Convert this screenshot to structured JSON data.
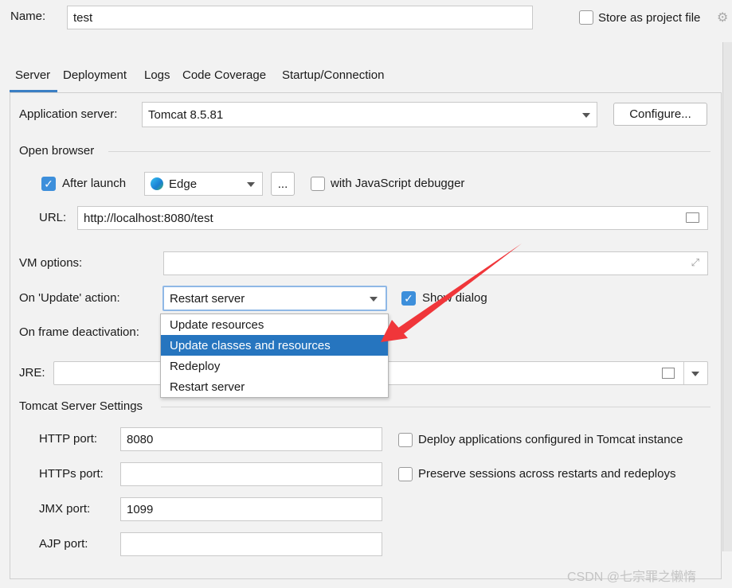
{
  "name": {
    "label": "Name:",
    "value": "test"
  },
  "store": {
    "label": "Store as project file",
    "checked": false
  },
  "tabs": [
    {
      "label": "Server",
      "active": true
    },
    {
      "label": "Deployment"
    },
    {
      "label": "Logs"
    },
    {
      "label": "Code Coverage"
    },
    {
      "label": "Startup/Connection"
    }
  ],
  "server": {
    "app_server_label": "Application server:",
    "app_server_value": "Tomcat 8.5.81",
    "configure": "Configure...",
    "open_browser": "Open browser",
    "after_launch": "After launch",
    "browser": "Edge",
    "browse_more": "...",
    "js_debugger": "with JavaScript debugger",
    "url_label": "URL:",
    "url_value": "http://localhost:8080/test",
    "vm_label": "VM options:",
    "vm_value": "",
    "update_label": "On 'Update' action:",
    "update_value": "Restart server",
    "show_dialog": "Show dialog",
    "frame_label": "On frame deactivation:",
    "jre_label": "JRE:",
    "jre_value": "",
    "dropdown": [
      "Update resources",
      "Update classes and resources",
      "Redeploy",
      "Restart server"
    ],
    "tomcat_settings": "Tomcat Server Settings",
    "http_label": "HTTP port:",
    "http_value": "8080",
    "https_label": "HTTPs port:",
    "https_value": "",
    "jmx_label": "JMX port:",
    "jmx_value": "1099",
    "ajp_label": "AJP port:",
    "ajp_value": "",
    "deploy_configured": "Deploy applications configured in Tomcat instance",
    "preserve_sessions": "Preserve sessions across restarts and redeploys"
  },
  "watermark": "CSDN @七宗罪之懒惰",
  "colors": {
    "accent": "#2675bf",
    "arrow": "#f0363a"
  }
}
